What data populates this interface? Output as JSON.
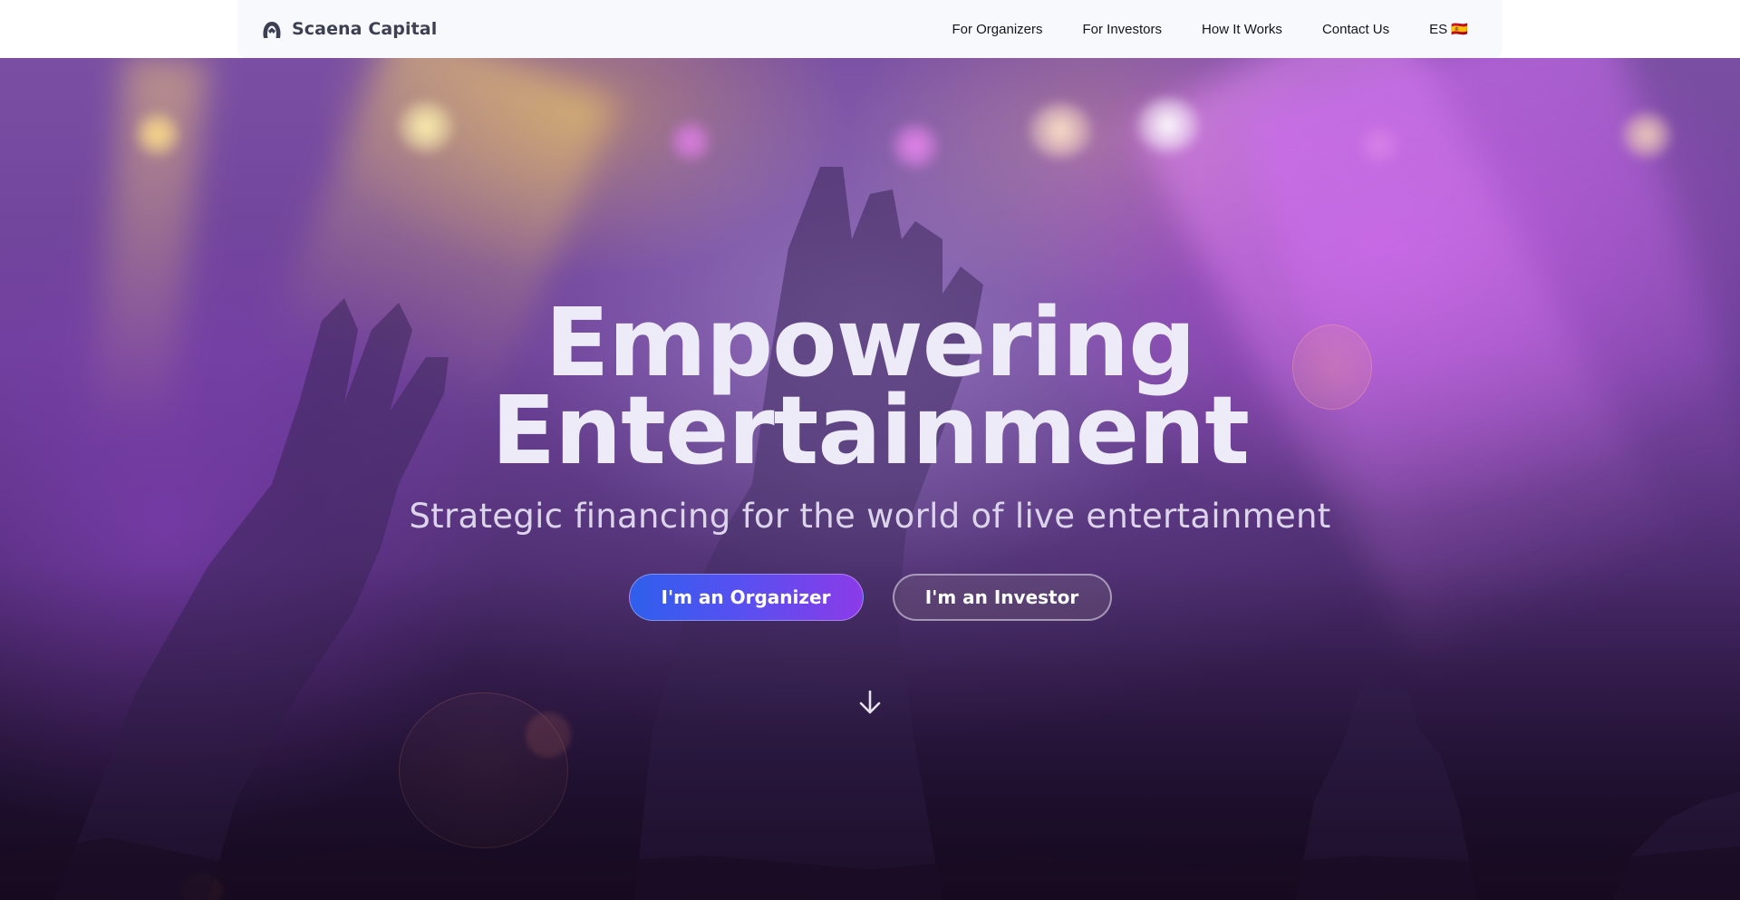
{
  "header": {
    "brand": "Scaena Capital",
    "nav": [
      {
        "label": "For Organizers"
      },
      {
        "label": "For Investors"
      },
      {
        "label": "How It Works"
      },
      {
        "label": "Contact Us"
      },
      {
        "label": "ES 🇪🇸"
      }
    ]
  },
  "hero": {
    "title_line1": "Empowering",
    "title_line2": "Entertainment",
    "subtitle": "Strategic financing for the world of live entertainment",
    "primary_cta": "I'm an Organizer",
    "secondary_cta": "I'm an Investor"
  },
  "colors": {
    "primary_gradient_start": "#2f5fec",
    "primary_gradient_end": "#8b3be8",
    "brand_text": "#3d4052",
    "hero_purple": "#6d3f99"
  },
  "icons": {
    "logo": "scaena-logo-icon",
    "scroll": "arrow-down-icon"
  }
}
